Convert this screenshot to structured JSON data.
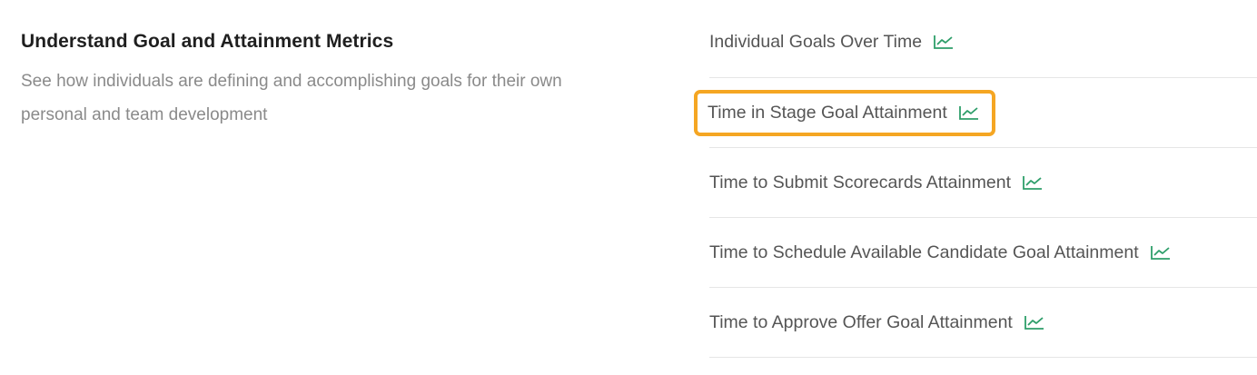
{
  "section": {
    "title": "Understand Goal and Attainment Metrics",
    "description": "See how individuals are defining and accomplishing goals for their own personal and team development"
  },
  "reports": [
    {
      "label": "Individual Goals Over Time",
      "icon": "trend-chart-icon",
      "highlighted": false
    },
    {
      "label": "Time in Stage Goal Attainment",
      "icon": "trend-chart-icon",
      "highlighted": true
    },
    {
      "label": "Time to Submit Scorecards Attainment",
      "icon": "trend-chart-icon",
      "highlighted": false
    },
    {
      "label": "Time to Schedule Available Candidate Goal Attainment",
      "icon": "trend-chart-icon",
      "highlighted": false
    },
    {
      "label": "Time to Approve Offer Goal Attainment",
      "icon": "trend-chart-icon",
      "highlighted": false
    }
  ],
  "colors": {
    "icon": "#2e9e6a",
    "highlight": "#f5a623",
    "title": "#1f1f1f",
    "description": "#8a8a8a",
    "link": "#555555",
    "divider": "#e6e6e6"
  }
}
